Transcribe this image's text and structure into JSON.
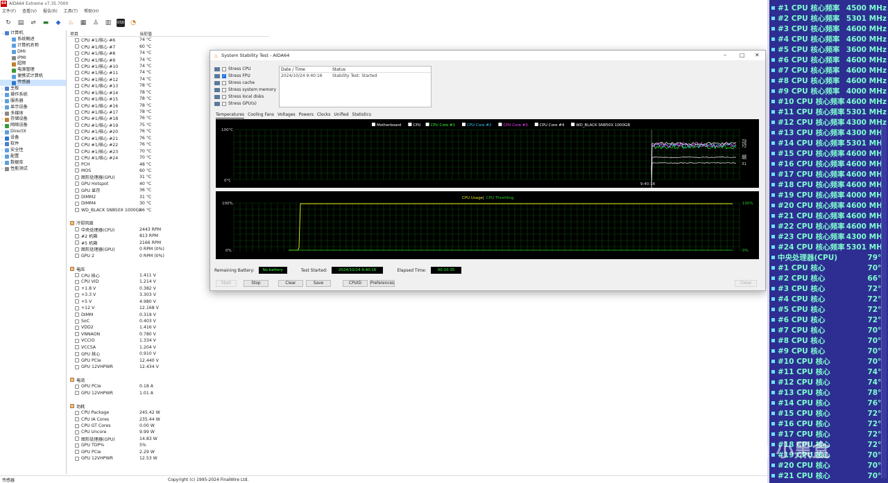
{
  "app": {
    "title": "AIDA64 Extreme v7.35.7000",
    "logo": "64",
    "menu": [
      "文件(F)",
      "查看(V)",
      "报告(R)",
      "工具(T)",
      "帮助(H)"
    ]
  },
  "tree": [
    {
      "label": "计算机",
      "level": 0,
      "exp": "⌄"
    },
    {
      "label": "系统概述",
      "level": 2,
      "exp": ""
    },
    {
      "label": "计算机名称",
      "level": 2,
      "exp": ""
    },
    {
      "label": "DMI",
      "level": 2,
      "exp": ""
    },
    {
      "label": "IPMI",
      "level": 2,
      "exp": ""
    },
    {
      "label": "超频",
      "level": 2,
      "exp": ""
    },
    {
      "label": "电源管理",
      "level": 2,
      "exp": ""
    },
    {
      "label": "便携式计算机",
      "level": 2,
      "exp": ""
    },
    {
      "label": "传感器",
      "level": 2,
      "exp": ""
    },
    {
      "label": "主板",
      "level": 0,
      "exp": "›"
    },
    {
      "label": "操作系统",
      "level": 0,
      "exp": "›"
    },
    {
      "label": "服务器",
      "level": 0,
      "exp": "›"
    },
    {
      "label": "显示设备",
      "level": 0,
      "exp": "›"
    },
    {
      "label": "多媒体",
      "level": 0,
      "exp": "›"
    },
    {
      "label": "存储设备",
      "level": 0,
      "exp": "›"
    },
    {
      "label": "网络设备",
      "level": 0,
      "exp": "›"
    },
    {
      "label": "DirectX",
      "level": 0,
      "exp": "›"
    },
    {
      "label": "设备",
      "level": 0,
      "exp": "›"
    },
    {
      "label": "软件",
      "level": 0,
      "exp": "›"
    },
    {
      "label": "安全性",
      "level": 0,
      "exp": "›"
    },
    {
      "label": "配置",
      "level": 0,
      "exp": "›"
    },
    {
      "label": "数据库",
      "level": 0,
      "exp": "›"
    },
    {
      "label": "性能测试",
      "level": 0,
      "exp": "›"
    }
  ],
  "list_header": {
    "item": "项目",
    "value": "当前值"
  },
  "list": [
    {
      "name": "CPU #1/核心 #6",
      "value": "74 °C"
    },
    {
      "name": "CPU #1/核心 #7",
      "value": "60 °C"
    },
    {
      "name": "CPU #1/核心 #8",
      "value": "74 °C"
    },
    {
      "name": "CPU #1/核心 #9",
      "value": "74 °C"
    },
    {
      "name": "CPU #1/核心 #10",
      "value": "74 °C"
    },
    {
      "name": "CPU #1/核心 #11",
      "value": "74 °C"
    },
    {
      "name": "CPU #1/核心 #12",
      "value": "74 °C"
    },
    {
      "name": "CPU #1/核心 #13",
      "value": "78 °C"
    },
    {
      "name": "CPU #1/核心 #14",
      "value": "78 °C"
    },
    {
      "name": "CPU #1/核心 #15",
      "value": "78 °C"
    },
    {
      "name": "CPU #1/核心 #16",
      "value": "78 °C"
    },
    {
      "name": "CPU #1/核心 #17",
      "value": "78 °C"
    },
    {
      "name": "CPU #1/核心 #18",
      "value": "76 °C"
    },
    {
      "name": "CPU #1/核心 #19",
      "value": "75 °C"
    },
    {
      "name": "CPU #1/核心 #20",
      "value": "76 °C"
    },
    {
      "name": "CPU #1/核心 #21",
      "value": "76 °C"
    },
    {
      "name": "CPU #1/核心 #22",
      "value": "76 °C"
    },
    {
      "name": "CPU #1/核心 #23",
      "value": "70 °C"
    },
    {
      "name": "CPU #1/核心 #24",
      "value": "70 °C"
    },
    {
      "name": "PCH",
      "value": "48 °C"
    },
    {
      "name": "MOS",
      "value": "60 °C"
    },
    {
      "name": "图形处理器(GPU)",
      "value": "31 °C"
    },
    {
      "name": "GPU Hotspot",
      "value": "40 °C"
    },
    {
      "name": "GPU 显存",
      "value": "36 °C"
    },
    {
      "name": "DIMM2",
      "value": "31 °C"
    },
    {
      "name": "DIMM4",
      "value": "30 °C"
    },
    {
      "name": "WD_BLACK SN850X 1000GB",
      "value": "46 °C"
    },
    {
      "name": "",
      "value": ""
    },
    {
      "name": "冷却风扇",
      "value": "",
      "sec": true
    },
    {
      "name": "中央处理器(CPU)",
      "value": "2443 RPM"
    },
    {
      "name": "#2 机箱",
      "value": "813 RPM"
    },
    {
      "name": "#5 机箱",
      "value": "2166 RPM"
    },
    {
      "name": "图形处理器(GPU)",
      "value": "0 RPM  (0%)"
    },
    {
      "name": "GPU 2",
      "value": "0 RPM  (0%)"
    },
    {
      "name": "",
      "value": ""
    },
    {
      "name": "电压",
      "value": "",
      "sec": true
    },
    {
      "name": "CPU 核心",
      "value": "1.411 V"
    },
    {
      "name": "CPU VID",
      "value": "1.214 V"
    },
    {
      "name": "+1.8 V",
      "value": "0.382 V"
    },
    {
      "name": "+3.3 V",
      "value": "3.303 V"
    },
    {
      "name": "+5 V",
      "value": "4.980 V"
    },
    {
      "name": "+12 V",
      "value": "12.168 V"
    },
    {
      "name": "DIMM",
      "value": "0.319 V"
    },
    {
      "name": "SoC",
      "value": "0.403 V"
    },
    {
      "name": "VDD2",
      "value": "1.416 V"
    },
    {
      "name": "VNNAON",
      "value": "0.780 V"
    },
    {
      "name": "VCCIO",
      "value": "1.334 V"
    },
    {
      "name": "VCCSA",
      "value": "1.204 V"
    },
    {
      "name": "GPU 核心",
      "value": "0.910 V"
    },
    {
      "name": "GPU PCIe",
      "value": "12.440 V"
    },
    {
      "name": "GPU 12VHPWR",
      "value": "12.434 V"
    },
    {
      "name": "",
      "value": ""
    },
    {
      "name": "电流",
      "value": "",
      "sec": true
    },
    {
      "name": "GPU PCIe",
      "value": "0.18 A"
    },
    {
      "name": "GPU 12VHPWR",
      "value": "1.01 A"
    },
    {
      "name": "",
      "value": ""
    },
    {
      "name": "功耗",
      "value": "",
      "sec": true
    },
    {
      "name": "CPU Package",
      "value": "245.42 W"
    },
    {
      "name": "CPU IA Cores",
      "value": "235.44 W"
    },
    {
      "name": "CPU GT Cores",
      "value": "0.00 W"
    },
    {
      "name": "CPU Uncore",
      "value": "9.99 W"
    },
    {
      "name": "图形处理器(GPU)",
      "value": "14.83 W"
    },
    {
      "name": "GPU TDP%",
      "value": "5%"
    },
    {
      "name": "GPU PCIe",
      "value": "2.29 W"
    },
    {
      "name": "GPU 12VHPWR",
      "value": "12.53 W"
    }
  ],
  "statusbar": {
    "left": "传感器",
    "copyright": "Copyright (c) 1995-2024 FinalWire Ltd."
  },
  "dialog": {
    "title": "System Stability Test - AIDA64",
    "options": [
      {
        "label": "Stress CPU",
        "checked": false
      },
      {
        "label": "Stress FPU",
        "checked": true
      },
      {
        "label": "Stress cache",
        "checked": false
      },
      {
        "label": "Stress system memory",
        "checked": false
      },
      {
        "label": "Stress local disks",
        "checked": false
      },
      {
        "label": "Stress GPU(s)",
        "checked": false
      }
    ],
    "log_headers": [
      "Date / Time",
      "Status"
    ],
    "log_rows": [
      {
        "time": "2024/10/24 9:40:16",
        "status": "Stability Test: Started"
      }
    ],
    "tabs": [
      "Temperatures",
      "Cooling Fans",
      "Voltages",
      "Powers",
      "Clocks",
      "Unified",
      "Statistics"
    ],
    "graph1": {
      "legend": [
        "Motherboard",
        "CPU",
        "CPU Core #1",
        "CPU Core #2",
        "CPU Core #3",
        "CPU Core #4",
        "WD_BLACK SN850X 1000GB"
      ],
      "legend_colors": [
        "#ffffff",
        "#ffffff",
        "#33ff33",
        "#33ccff",
        "#ff44ff",
        "#ffffff",
        "#ffffff"
      ],
      "ymax": "100°C",
      "ymin": "0°C",
      "time": "9:40:16",
      "right_labels": [
        "79",
        "76",
        "72",
        "48",
        "46",
        "31"
      ]
    },
    "graph2": {
      "title_a": "CPU Usage",
      "sep": "|",
      "title_b": "CPU Throttling",
      "ymax": "100%",
      "ymin": "0%",
      "rmax": "100%",
      "rmin": "0%"
    },
    "remaining_label": "Remaining Battery:",
    "remaining_value": "No battery",
    "started_label": "Test Started:",
    "started_value": "2024/10/24 9:40:16",
    "elapsed_label": "Elapsed Time:",
    "elapsed_value": "00:10:35",
    "buttons": {
      "start": "Start",
      "stop": "Stop",
      "clear": "Clear",
      "save": "Save",
      "cpuid": "CPUID",
      "prefs": "Preferences",
      "close": "Close"
    }
  },
  "osd": [
    {
      "label": "#1 CPU 核心频率",
      "value": "4500 MHz"
    },
    {
      "label": "#2 CPU 核心频率",
      "value": "5301 MHz"
    },
    {
      "label": "#3 CPU 核心频率",
      "value": "4600 MHz"
    },
    {
      "label": "#4 CPU 核心频率",
      "value": "4600 MHz"
    },
    {
      "label": "#5 CPU 核心频率",
      "value": "3600 MHz"
    },
    {
      "label": "#6 CPU 核心频率",
      "value": "4600 MHz"
    },
    {
      "label": "#7 CPU 核心频率",
      "value": "4600 MHz"
    },
    {
      "label": "#8 CPU 核心频率",
      "value": "4600 MHz"
    },
    {
      "label": "#9 CPU 核心频率",
      "value": "4000 MHz"
    },
    {
      "label": "#10 CPU 核心频率",
      "value": "4600 MHz"
    },
    {
      "label": "#11 CPU 核心频率",
      "value": "5301 MHz"
    },
    {
      "label": "#12 CPU 核心频率",
      "value": "4300 MHz"
    },
    {
      "label": "#13 CPU 核心频率",
      "value": "4300 MHz"
    },
    {
      "label": "#14 CPU 核心频率",
      "value": "5301 MHz"
    },
    {
      "label": "#15 CPU 核心频率",
      "value": "4600 MHz"
    },
    {
      "label": "#16 CPU 核心频率",
      "value": "4600 MHz"
    },
    {
      "label": "#17 CPU 核心频率",
      "value": "4600 MHz"
    },
    {
      "label": "#18 CPU 核心频率",
      "value": "4600 MHz"
    },
    {
      "label": "#19 CPU 核心频率",
      "value": "4000 MHz"
    },
    {
      "label": "#20 CPU 核心频率",
      "value": "4600 MHz"
    },
    {
      "label": "#21 CPU 核心频率",
      "value": "4600 MHz"
    },
    {
      "label": "#22 CPU 核心频率",
      "value": "4600 MHz"
    },
    {
      "label": "#23 CPU 核心频率",
      "value": "4300 MHz"
    },
    {
      "label": "#24 CPU 核心频率",
      "value": "5301 MHz"
    },
    {
      "label": "中央处理器(CPU)",
      "value": "79°C"
    },
    {
      "label": "#1 CPU 核心",
      "value": "70°C"
    },
    {
      "label": "#2 CPU 核心",
      "value": "66°C"
    },
    {
      "label": "#3 CPU 核心",
      "value": "72°C"
    },
    {
      "label": "#4 CPU 核心",
      "value": "72°C"
    },
    {
      "label": "#5 CPU 核心",
      "value": "72°C"
    },
    {
      "label": "#6 CPU 核心",
      "value": "72°C"
    },
    {
      "label": "#7 CPU 核心",
      "value": "70°C"
    },
    {
      "label": "#8 CPU 核心",
      "value": "70°C"
    },
    {
      "label": "#9 CPU 核心",
      "value": "70°C"
    },
    {
      "label": "#10 CPU 核心",
      "value": "70°C"
    },
    {
      "label": "#11 CPU 核心",
      "value": "74°C"
    },
    {
      "label": "#12 CPU 核心",
      "value": "74°C"
    },
    {
      "label": "#13 CPU 核心",
      "value": "78°C"
    },
    {
      "label": "#14 CPU 核心",
      "value": "76°C"
    },
    {
      "label": "#15 CPU 核心",
      "value": "72°C"
    },
    {
      "label": "#16 CPU 核心",
      "value": "72°C"
    },
    {
      "label": "#17 CPU 核心",
      "value": "72°C"
    },
    {
      "label": "#18 CPU 核心",
      "value": "72°C"
    },
    {
      "label": "#19 CPU 核心",
      "value": "70°C"
    },
    {
      "label": "#20 CPU 核心",
      "value": "70°C"
    },
    {
      "label": "#21 CPU 核心",
      "value": "70°C"
    }
  ],
  "colors": {
    "osd_bg": "#2e2e92",
    "osd_text": "#7fffd0",
    "graph_green": "#2bd42b",
    "grid": "#0a4a0a"
  }
}
